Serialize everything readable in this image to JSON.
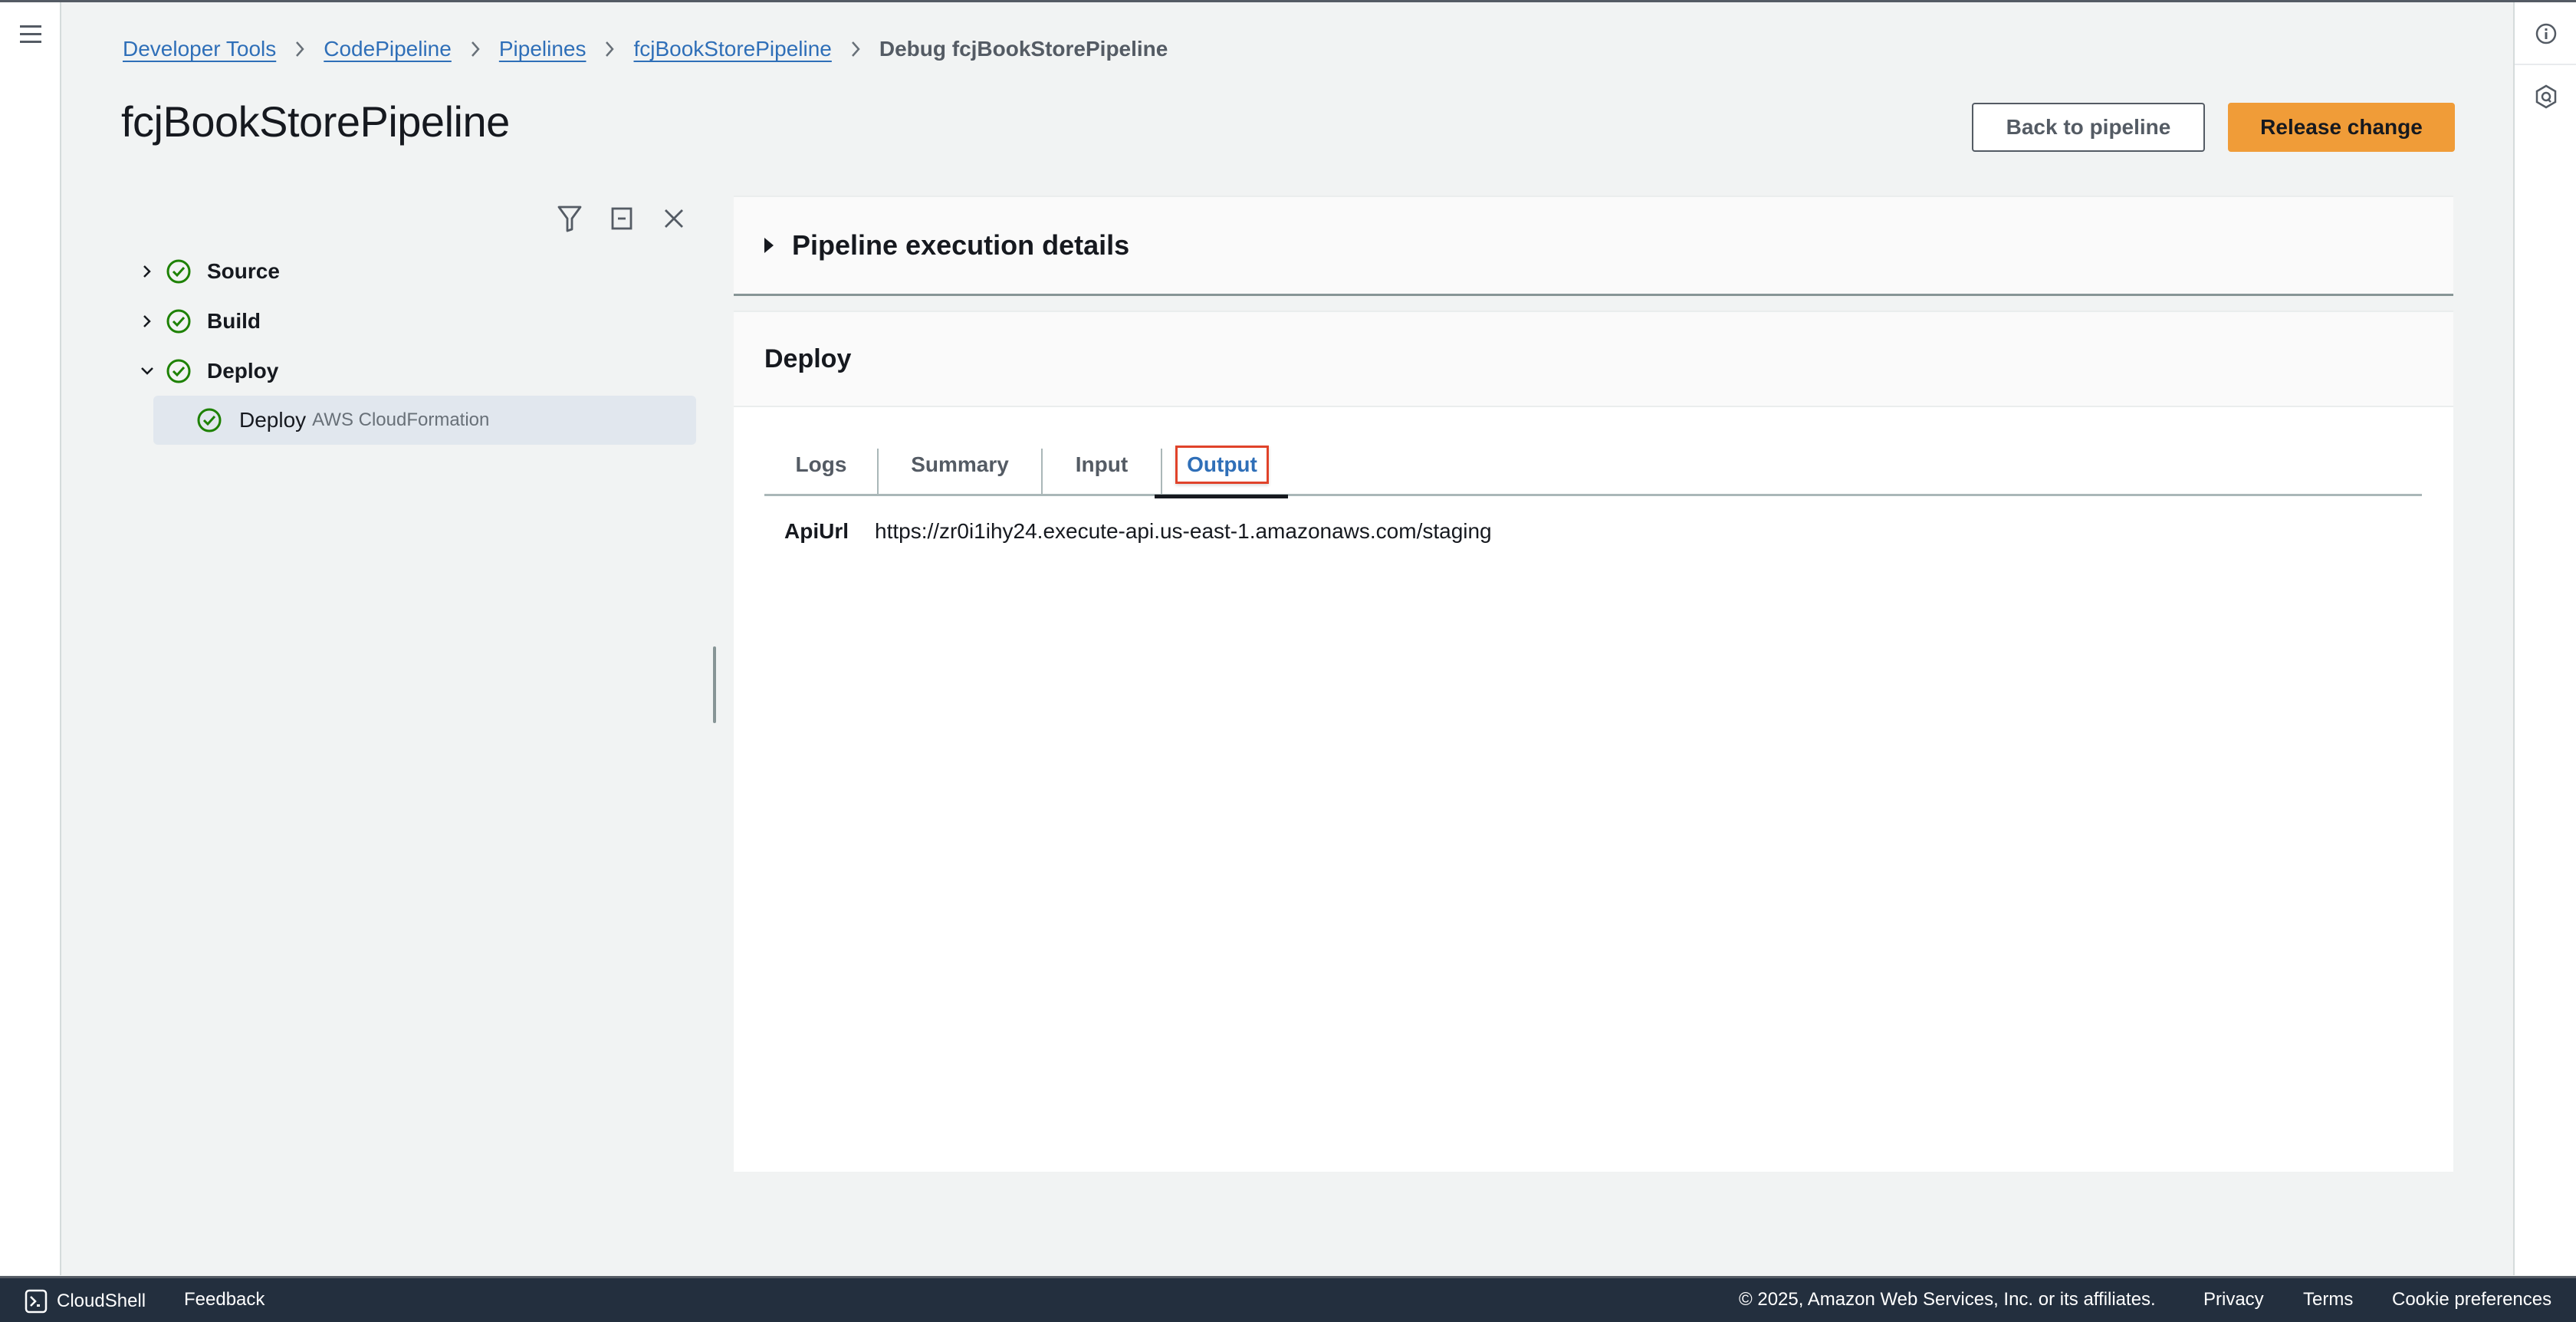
{
  "breadcrumb": {
    "items": [
      "Developer Tools",
      "CodePipeline",
      "Pipelines",
      "fcjBookStorePipeline"
    ],
    "current": "Debug fcjBookStorePipeline"
  },
  "page": {
    "title": "fcjBookStorePipeline"
  },
  "actions": {
    "back_label": "Back to pipeline",
    "release_label": "Release change"
  },
  "tree": {
    "toolbar_icons": [
      "filter-icon",
      "collapse-all-icon",
      "close-icon"
    ],
    "stages": [
      {
        "label": "Source",
        "status": "succeeded",
        "expanded": false
      },
      {
        "label": "Build",
        "status": "succeeded",
        "expanded": false
      },
      {
        "label": "Deploy",
        "status": "succeeded",
        "expanded": true
      }
    ],
    "selected_action": {
      "label": "Deploy",
      "provider": "AWS CloudFormation",
      "status": "succeeded"
    }
  },
  "execution_details": {
    "label": "Pipeline execution details",
    "expanded": false
  },
  "action_panel": {
    "title": "Deploy",
    "tabs": [
      {
        "label": "Logs",
        "active": false
      },
      {
        "label": "Summary",
        "active": false
      },
      {
        "label": "Input",
        "active": false
      },
      {
        "label": "Output",
        "active": true
      }
    ],
    "outputs": [
      {
        "key": "ApiUrl",
        "value": "https://zr0i1ihy24.execute-api.us-east-1.amazonaws.com/staging"
      }
    ]
  },
  "footer": {
    "cloudshell": "CloudShell",
    "feedback": "Feedback",
    "copyright": "© 2025, Amazon Web Services, Inc. or its affiliates.",
    "privacy": "Privacy",
    "terms": "Terms",
    "cookies": "Cookie preferences"
  },
  "colors": {
    "link": "#2f6fb8",
    "primary_button": "#f09c38",
    "success": "#1d8102",
    "footer_bg": "#232f3e",
    "highlight_box": "#e0432a"
  }
}
